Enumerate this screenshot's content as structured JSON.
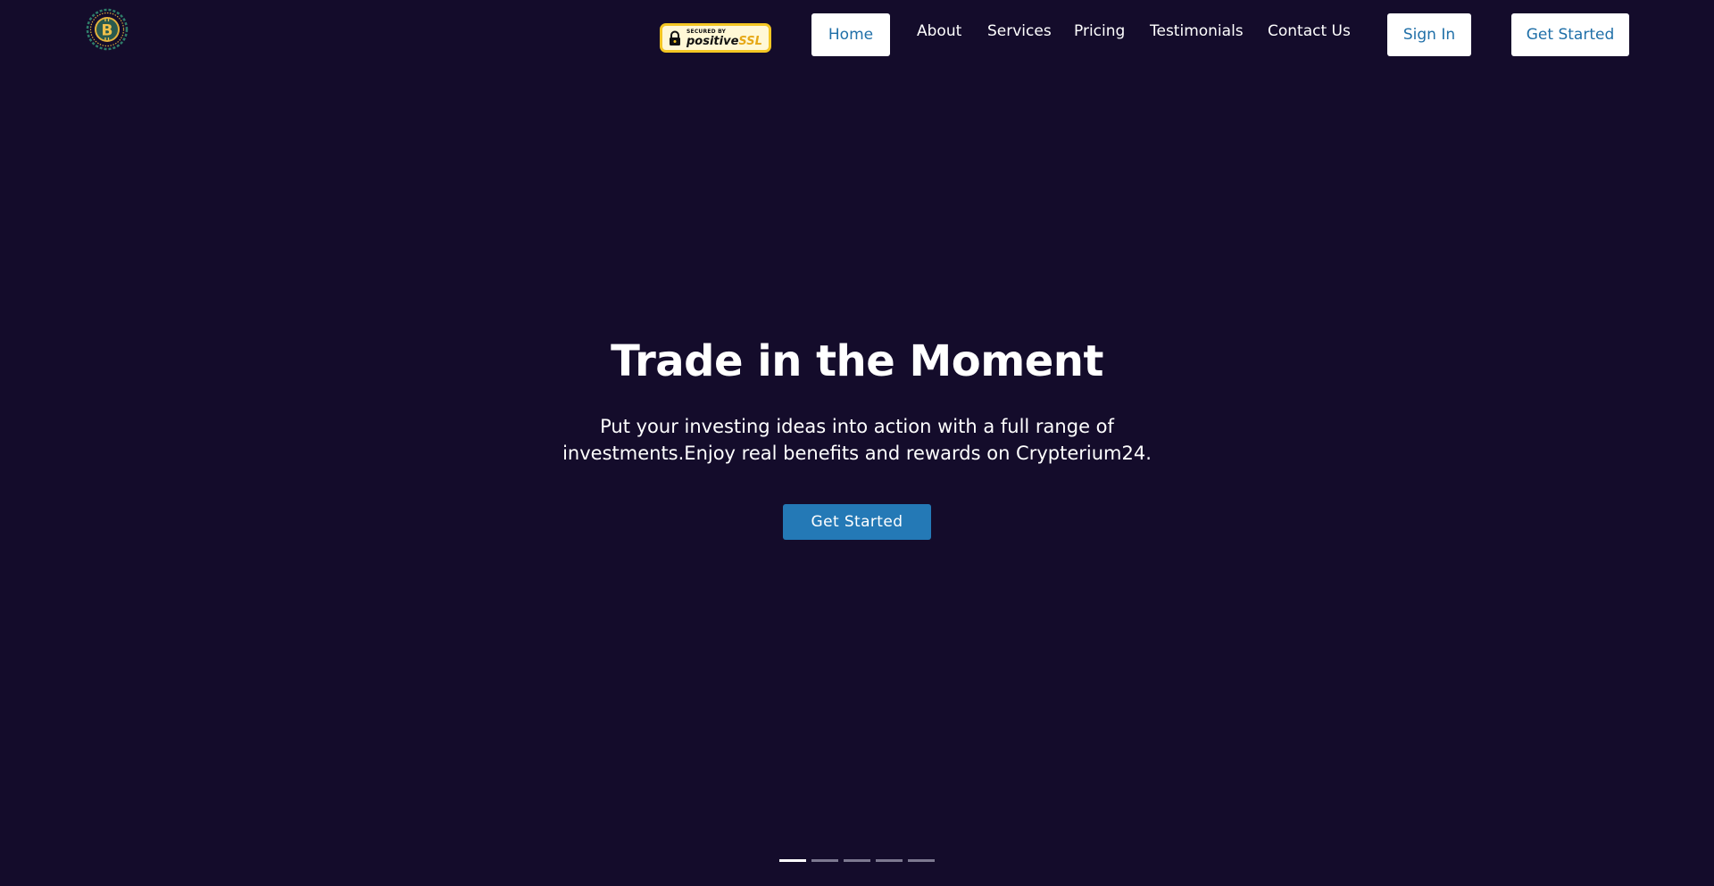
{
  "header": {
    "logo_icon": "bitcoin-coin-icon",
    "ssl_badge": {
      "secured_by": "SECURED BY",
      "brand_main": "positive",
      "brand_accent": "SSL",
      "icon": "lock-icon"
    },
    "nav": {
      "home": "Home",
      "about": "About",
      "services": "Services",
      "pricing": "Pricing",
      "testimonials": "Testimonials",
      "contact": "Contact Us"
    },
    "sign_in_label": "Sign In",
    "get_started_label": "Get Started"
  },
  "hero": {
    "title": "Trade in the Moment",
    "subtitle": "Put your investing ideas into action with a full range of investments.Enjoy real benefits and rewards on Crypterium24.",
    "cta_label": "Get Started",
    "slides": {
      "count": 5,
      "active_index": 0
    }
  },
  "colors": {
    "background": "#140c2b",
    "accent_blue": "#2479b6",
    "link_blue": "#1f6fa8",
    "logo_gold": "#e3b23c",
    "logo_green": "#2f7d6a"
  }
}
